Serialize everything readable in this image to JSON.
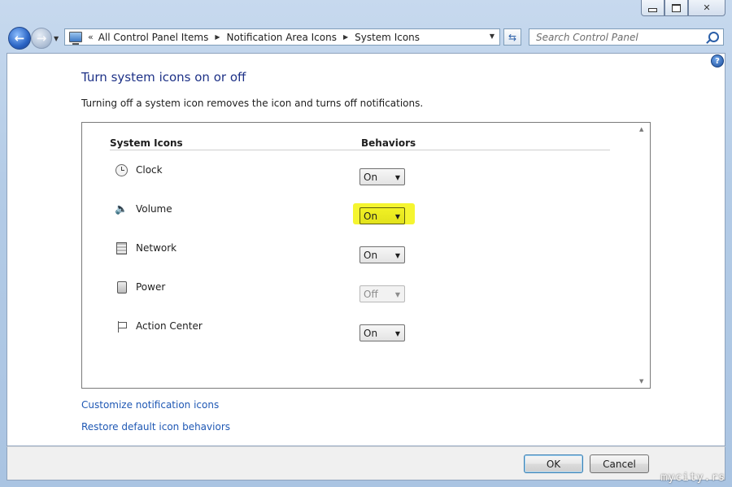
{
  "nav": {
    "back_glyph": "←",
    "forward_glyph": "→"
  },
  "address": {
    "prefix": "«",
    "crumbs": [
      "All Control Panel Items",
      "Notification Area Icons",
      "System Icons"
    ]
  },
  "search": {
    "placeholder": "Search Control Panel"
  },
  "page": {
    "title": "Turn system icons on or off",
    "description": "Turning off a system icon removes the icon and turns off notifications."
  },
  "table": {
    "header_icons": "System Icons",
    "header_behaviors": "Behaviors",
    "rows": [
      {
        "label": "Clock",
        "icon": "clock-icon",
        "value": "On",
        "disabled": false,
        "highlighted": false
      },
      {
        "label": "Volume",
        "icon": "volume-icon",
        "value": "On",
        "disabled": false,
        "highlighted": true
      },
      {
        "label": "Network",
        "icon": "network-icon",
        "value": "On",
        "disabled": false,
        "highlighted": false
      },
      {
        "label": "Power",
        "icon": "power-icon",
        "value": "Off",
        "disabled": true,
        "highlighted": false
      },
      {
        "label": "Action Center",
        "icon": "flag-icon",
        "value": "On",
        "disabled": false,
        "highlighted": false
      }
    ]
  },
  "links": {
    "customize": "Customize notification icons",
    "restore": "Restore default icon behaviors"
  },
  "buttons": {
    "ok": "OK",
    "cancel": "Cancel"
  },
  "watermark": "mycity.rs",
  "colors": {
    "highlight": "#f5f530",
    "link": "#1f58b4",
    "title": "#1e3287"
  }
}
